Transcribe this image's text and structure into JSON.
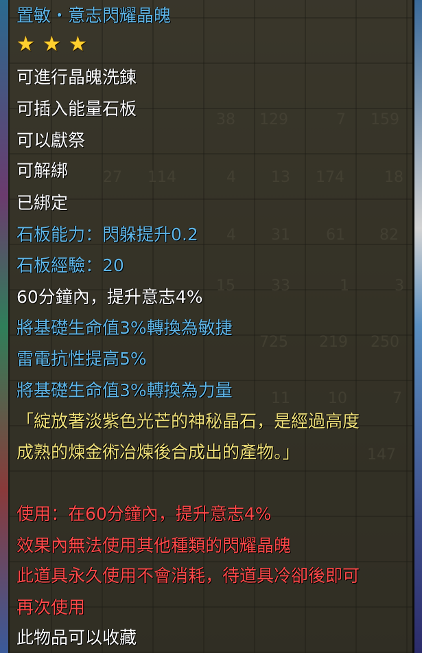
{
  "item": {
    "title": "置敏・意志閃耀晶魄",
    "star_count": 3,
    "star_icon": "star-icon",
    "colors": {
      "title": "#5fb6e8",
      "white": "#ffffff",
      "blue": "#5fb6e8",
      "yellow": "#efe07a",
      "red": "#ff4a4a"
    },
    "properties": [
      "可進行晶魄洗鍊",
      "可插入能量石板",
      "可以獻祭",
      "可解綁",
      "已綁定"
    ],
    "slab_ability": "石板能力：閃躲提升0.2",
    "slab_exp": "石板經驗：20",
    "effects": [
      "60分鐘內，提升意志4%",
      "將基礎生命值3%轉換為敏捷",
      "雷電抗性提高5%",
      "將基礎生命值3%轉換為力量"
    ],
    "description": [
      "「綻放著淡紫色光芒的神秘晶石，是經過高度",
      "成熟的煉金術冶煉後合成出的產物。」"
    ],
    "usage": [
      "使用：在60分鐘內，提升意志4%",
      "效果內無法使用其他種類的閃耀晶魄",
      "此道具永久使用不會消耗，待道具冷卻後即可",
      "再次使用"
    ],
    "footer": "此物品可以收藏"
  },
  "background_stack_counts": [
    "38",
    "129",
    "7",
    "159",
    "27",
    "114",
    "4",
    "13",
    "174",
    "18",
    "4",
    "31",
    "61",
    "82",
    "15",
    "33",
    "1",
    "3",
    "725",
    "219",
    "250",
    "11",
    "10",
    "7",
    "147"
  ]
}
